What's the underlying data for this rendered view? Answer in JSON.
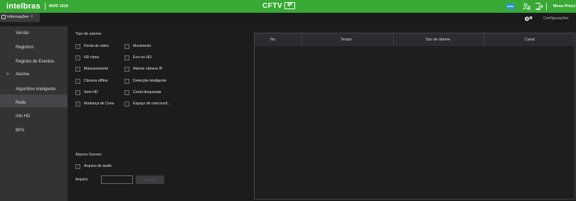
{
  "topbar": {
    "brand": "intelbras",
    "model": "INVD 1016",
    "center_title": "CFTV",
    "center_badge": "IP",
    "menu_principal": "Menu Princi",
    "icons": [
      "network-status-icon",
      "users-icon",
      "logout-icon"
    ],
    "accent": "#39a935"
  },
  "tabs": [
    {
      "label": "Informações",
      "close": "×"
    }
  ],
  "config": {
    "label": "Configurações",
    "icon": "gears-icon"
  },
  "sidebar": {
    "items": [
      {
        "label": "Versão"
      },
      {
        "label": "Registros"
      },
      {
        "label": "Registro de Eventos"
      },
      {
        "label": "Alarme",
        "active": true,
        "marker": ">"
      },
      {
        "label": "Algorítimo inteligente"
      },
      {
        "label": "Rede"
      },
      {
        "label": "Info HD"
      },
      {
        "label": "BPS"
      }
    ]
  },
  "alarm_types": {
    "title": "Tipo de alarme",
    "left": [
      "Perda de vídeo",
      "HD cheio",
      "Mascaramento",
      "Câmera offline",
      "Sem HD",
      "Mudança de Cena"
    ],
    "right": [
      "Movimento",
      "Erro no HD",
      "Alarme câmera IP",
      "Detecção inteligente",
      "Conta bloqueada",
      "Espaço de cota insuf..."
    ]
  },
  "table": {
    "columns": [
      "No.",
      "Tempo",
      "Tipo de alarme",
      "Canal"
    ],
    "rows": []
  },
  "sound": {
    "title": "Alarme Sonoro",
    "audio_file_label": "Arquivo de áudio",
    "file_label": "Arquivo",
    "file_value": "",
    "browse_label": "Procurar"
  }
}
